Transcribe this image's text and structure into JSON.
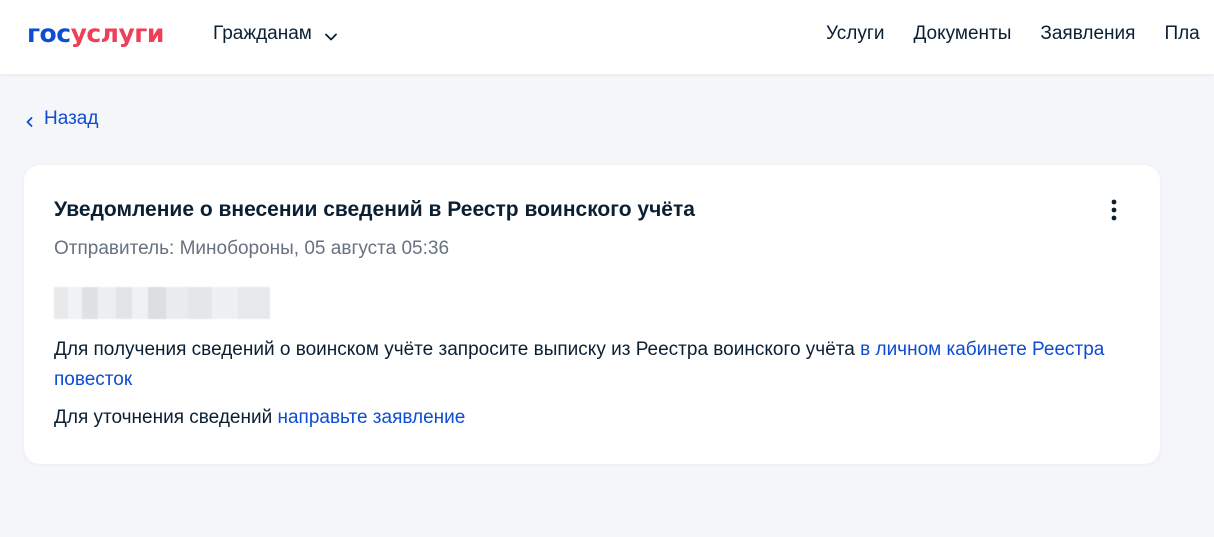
{
  "header": {
    "logo": {
      "part1": "гос",
      "part2": "услуги"
    },
    "role_selector": "Гражданам",
    "nav": [
      "Услуги",
      "Документы",
      "Заявления",
      "Пла"
    ]
  },
  "back": {
    "label": "Назад"
  },
  "notification": {
    "title": "Уведомление о внесении сведений в Реестр воинского учёта",
    "sender": "Отправитель: Минобороны, 05 августа 05:36",
    "paragraph1": {
      "text": "Для получения сведений о воинском учёте запросите выписку из Реестра воинского учёта ",
      "link": "в личном кабинете Реестра повесток"
    },
    "paragraph2": {
      "text": "Для уточнения сведений ",
      "link": "направьте заявление"
    }
  },
  "colors": {
    "brand_blue": "#0d4cd3",
    "brand_red": "#ee3f58",
    "text": "#0b1f33",
    "muted": "#66727f",
    "background": "#f5f6f9"
  },
  "icons": [
    "chevron-down-icon",
    "chevron-left-icon",
    "more-vertical-icon"
  ]
}
